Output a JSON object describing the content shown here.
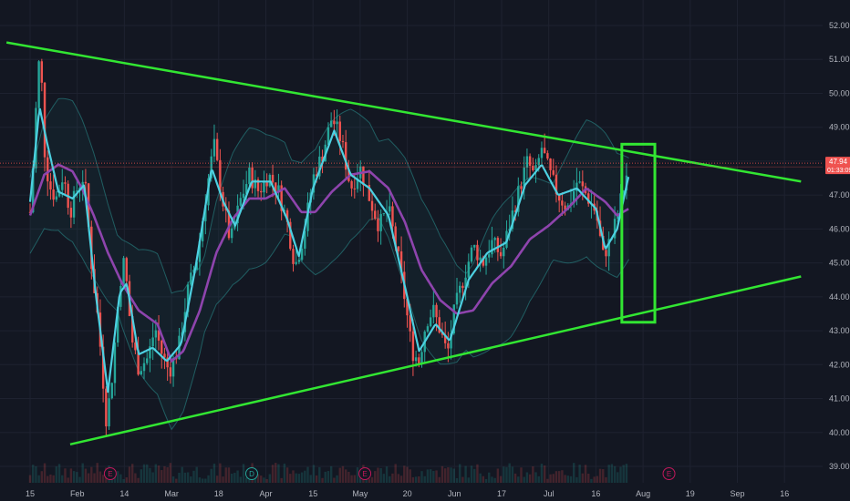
{
  "chart_data": {
    "type": "candlestick",
    "y_axis": {
      "position": "right",
      "ylim": [
        38.6,
        52.6
      ],
      "ticks": [
        "52.00",
        "51.00",
        "50.00",
        "49.00",
        "48.00",
        "47.00",
        "46.00",
        "45.00",
        "44.00",
        "43.00",
        "42.00",
        "41.00",
        "40.00",
        "39.00"
      ]
    },
    "current_price": {
      "value": 47.94,
      "label": "47.94",
      "countdown": "01:33:09"
    },
    "x_axis": {
      "ticks": [
        "15",
        "Feb",
        "14",
        "Mar",
        "18",
        "Apr",
        "15",
        "May",
        "20",
        "Jun",
        "17",
        "Jul",
        "16",
        "Aug",
        "19",
        "Sep",
        "16"
      ]
    },
    "events": [
      {
        "label": "E",
        "tick_index": 1.7,
        "color": "#c2185b"
      },
      {
        "label": "D",
        "tick_index": 4.7,
        "color": "#26a69a"
      },
      {
        "label": "E",
        "tick_index": 7.1,
        "color": "#c2185b"
      },
      {
        "label": "E",
        "tick_index": 13.55,
        "color": "#c2185b"
      }
    ],
    "price_path": [
      {
        "t": 0.0,
        "p": 46.5
      },
      {
        "t": 0.08,
        "p": 48.2
      },
      {
        "t": 0.16,
        "p": 50.6
      },
      {
        "t": 0.22,
        "p": 51.2
      },
      {
        "t": 0.3,
        "p": 48.4
      },
      {
        "t": 0.4,
        "p": 47.3
      },
      {
        "t": 0.55,
        "p": 46.9
      },
      {
        "t": 0.7,
        "p": 47.6
      },
      {
        "t": 0.85,
        "p": 46.5
      },
      {
        "t": 1.0,
        "p": 47.2
      },
      {
        "t": 1.15,
        "p": 47.6
      },
      {
        "t": 1.3,
        "p": 45.0
      },
      {
        "t": 1.45,
        "p": 43.2
      },
      {
        "t": 1.62,
        "p": 40.3
      },
      {
        "t": 1.75,
        "p": 41.8
      },
      {
        "t": 1.9,
        "p": 44.4
      },
      {
        "t": 2.0,
        "p": 45.1
      },
      {
        "t": 2.15,
        "p": 42.8
      },
      {
        "t": 2.3,
        "p": 41.9
      },
      {
        "t": 2.5,
        "p": 42.2
      },
      {
        "t": 2.65,
        "p": 43.1
      },
      {
        "t": 2.8,
        "p": 42.3
      },
      {
        "t": 2.95,
        "p": 41.8
      },
      {
        "t": 3.15,
        "p": 42.5
      },
      {
        "t": 3.35,
        "p": 44.2
      },
      {
        "t": 3.55,
        "p": 45.2
      },
      {
        "t": 3.75,
        "p": 47.2
      },
      {
        "t": 3.9,
        "p": 48.5
      },
      {
        "t": 4.05,
        "p": 47.1
      },
      {
        "t": 4.25,
        "p": 45.6
      },
      {
        "t": 4.45,
        "p": 46.8
      },
      {
        "t": 4.65,
        "p": 47.6
      },
      {
        "t": 4.85,
        "p": 47.1
      },
      {
        "t": 5.05,
        "p": 47.6
      },
      {
        "t": 5.25,
        "p": 47.2
      },
      {
        "t": 5.45,
        "p": 46.2
      },
      {
        "t": 5.62,
        "p": 44.9
      },
      {
        "t": 5.8,
        "p": 45.8
      },
      {
        "t": 6.0,
        "p": 47.5
      },
      {
        "t": 6.2,
        "p": 48.2
      },
      {
        "t": 6.4,
        "p": 49.3
      },
      {
        "t": 6.6,
        "p": 48.6
      },
      {
        "t": 6.8,
        "p": 47.2
      },
      {
        "t": 7.0,
        "p": 47.8
      },
      {
        "t": 7.2,
        "p": 46.9
      },
      {
        "t": 7.4,
        "p": 46.1
      },
      {
        "t": 7.6,
        "p": 46.6
      },
      {
        "t": 7.8,
        "p": 45.2
      },
      {
        "t": 7.95,
        "p": 43.9
      },
      {
        "t": 8.1,
        "p": 42.4
      },
      {
        "t": 8.25,
        "p": 42.1
      },
      {
        "t": 8.4,
        "p": 43.3
      },
      {
        "t": 8.55,
        "p": 43.6
      },
      {
        "t": 8.7,
        "p": 43.0
      },
      {
        "t": 8.85,
        "p": 42.3
      },
      {
        "t": 9.0,
        "p": 43.6
      },
      {
        "t": 9.2,
        "p": 44.6
      },
      {
        "t": 9.4,
        "p": 45.5
      },
      {
        "t": 9.6,
        "p": 45.0
      },
      {
        "t": 9.8,
        "p": 45.6
      },
      {
        "t": 10.0,
        "p": 45.2
      },
      {
        "t": 10.2,
        "p": 46.3
      },
      {
        "t": 10.4,
        "p": 47.3
      },
      {
        "t": 10.55,
        "p": 48.0
      },
      {
        "t": 10.7,
        "p": 47.5
      },
      {
        "t": 10.85,
        "p": 48.4
      },
      {
        "t": 11.0,
        "p": 47.7
      },
      {
        "t": 11.2,
        "p": 47.0
      },
      {
        "t": 11.4,
        "p": 46.6
      },
      {
        "t": 11.6,
        "p": 47.4
      },
      {
        "t": 11.8,
        "p": 47.0
      },
      {
        "t": 12.0,
        "p": 46.5
      },
      {
        "t": 12.15,
        "p": 45.2
      },
      {
        "t": 12.35,
        "p": 45.8
      },
      {
        "t": 12.55,
        "p": 47.0
      },
      {
        "t": 12.7,
        "p": 47.9
      }
    ],
    "ma_fast": [
      {
        "t": 0.0,
        "p": 46.8
      },
      {
        "t": 0.2,
        "p": 49.6
      },
      {
        "t": 0.35,
        "p": 48.6
      },
      {
        "t": 0.6,
        "p": 47.1
      },
      {
        "t": 0.9,
        "p": 46.9
      },
      {
        "t": 1.15,
        "p": 47.3
      },
      {
        "t": 1.4,
        "p": 44.0
      },
      {
        "t": 1.65,
        "p": 41.2
      },
      {
        "t": 1.9,
        "p": 44.1
      },
      {
        "t": 2.05,
        "p": 44.4
      },
      {
        "t": 2.3,
        "p": 42.3
      },
      {
        "t": 2.6,
        "p": 42.5
      },
      {
        "t": 2.9,
        "p": 42.1
      },
      {
        "t": 3.2,
        "p": 42.6
      },
      {
        "t": 3.5,
        "p": 44.8
      },
      {
        "t": 3.85,
        "p": 47.8
      },
      {
        "t": 4.1,
        "p": 46.8
      },
      {
        "t": 4.35,
        "p": 46.1
      },
      {
        "t": 4.7,
        "p": 47.4
      },
      {
        "t": 5.1,
        "p": 47.4
      },
      {
        "t": 5.45,
        "p": 46.3
      },
      {
        "t": 5.7,
        "p": 45.2
      },
      {
        "t": 6.0,
        "p": 47.2
      },
      {
        "t": 6.45,
        "p": 48.9
      },
      {
        "t": 6.8,
        "p": 47.6
      },
      {
        "t": 7.2,
        "p": 47.2
      },
      {
        "t": 7.6,
        "p": 46.4
      },
      {
        "t": 7.95,
        "p": 44.3
      },
      {
        "t": 8.25,
        "p": 42.4
      },
      {
        "t": 8.6,
        "p": 43.2
      },
      {
        "t": 8.9,
        "p": 42.7
      },
      {
        "t": 9.3,
        "p": 44.5
      },
      {
        "t": 9.7,
        "p": 45.3
      },
      {
        "t": 10.1,
        "p": 45.6
      },
      {
        "t": 10.5,
        "p": 47.3
      },
      {
        "t": 10.85,
        "p": 47.9
      },
      {
        "t": 11.2,
        "p": 47.0
      },
      {
        "t": 11.6,
        "p": 47.2
      },
      {
        "t": 12.0,
        "p": 46.6
      },
      {
        "t": 12.2,
        "p": 45.4
      },
      {
        "t": 12.45,
        "p": 46.0
      },
      {
        "t": 12.7,
        "p": 47.6
      }
    ],
    "ma_slow": [
      {
        "t": 0.0,
        "p": 46.4
      },
      {
        "t": 0.3,
        "p": 47.6
      },
      {
        "t": 0.6,
        "p": 47.9
      },
      {
        "t": 0.9,
        "p": 47.7
      },
      {
        "t": 1.1,
        "p": 47.2
      },
      {
        "t": 1.35,
        "p": 46.4
      },
      {
        "t": 1.65,
        "p": 45.3
      },
      {
        "t": 1.95,
        "p": 44.4
      },
      {
        "t": 2.3,
        "p": 43.6
      },
      {
        "t": 2.7,
        "p": 43.2
      },
      {
        "t": 3.0,
        "p": 42.1
      },
      {
        "t": 3.25,
        "p": 42.4
      },
      {
        "t": 3.6,
        "p": 43.6
      },
      {
        "t": 3.95,
        "p": 45.3
      },
      {
        "t": 4.3,
        "p": 46.3
      },
      {
        "t": 4.65,
        "p": 46.9
      },
      {
        "t": 5.0,
        "p": 46.9
      },
      {
        "t": 5.4,
        "p": 47.2
      },
      {
        "t": 5.75,
        "p": 46.5
      },
      {
        "t": 6.05,
        "p": 46.5
      },
      {
        "t": 6.4,
        "p": 47.1
      },
      {
        "t": 6.8,
        "p": 47.6
      },
      {
        "t": 7.2,
        "p": 47.7
      },
      {
        "t": 7.6,
        "p": 47.2
      },
      {
        "t": 7.95,
        "p": 46.2
      },
      {
        "t": 8.3,
        "p": 44.8
      },
      {
        "t": 8.7,
        "p": 43.9
      },
      {
        "t": 9.05,
        "p": 43.5
      },
      {
        "t": 9.4,
        "p": 43.6
      },
      {
        "t": 9.8,
        "p": 44.4
      },
      {
        "t": 10.2,
        "p": 44.9
      },
      {
        "t": 10.6,
        "p": 45.7
      },
      {
        "t": 11.0,
        "p": 46.1
      },
      {
        "t": 11.4,
        "p": 46.6
      },
      {
        "t": 11.8,
        "p": 47.2
      },
      {
        "t": 12.2,
        "p": 46.8
      },
      {
        "t": 12.45,
        "p": 46.4
      },
      {
        "t": 12.7,
        "p": 46.6
      }
    ],
    "band_width": 1.6,
    "trendlines": [
      {
        "name": "upper",
        "start": {
          "t": -0.5,
          "p": 51.5
        },
        "end": {
          "t": 16.35,
          "p": 47.4
        },
        "color": "#32e632"
      },
      {
        "name": "lower",
        "start": {
          "t": 0.85,
          "p": 39.65
        },
        "end": {
          "t": 16.35,
          "p": 44.6
        },
        "color": "#32e632"
      }
    ],
    "highlight_box": {
      "t0": 12.55,
      "t1": 13.25,
      "p0": 48.5,
      "p1": 43.25,
      "color": "#32e632"
    },
    "colors": {
      "background": "#131722",
      "up": "#26a69a",
      "down": "#ef5350",
      "ma_fast": "#4dd0e1",
      "ma_slow": "#8e44ad",
      "band": "#2a8a8a",
      "price_line": "#ef5350",
      "axis_text": "#b2b5be",
      "grid": "#1e2230"
    }
  }
}
